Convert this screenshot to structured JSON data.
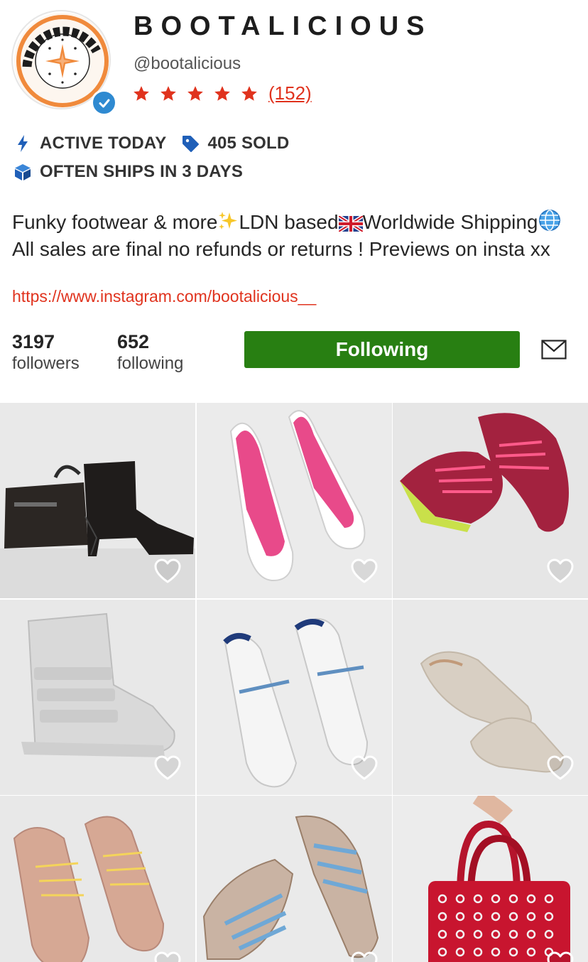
{
  "profile": {
    "name": "BOOTALICIOUS",
    "handle": "@bootalicious",
    "rating_stars": 5,
    "reviews": "(152)",
    "avatar_icon": "bootalicious-logo",
    "verified_icon": "verified-check-icon"
  },
  "badges": {
    "active": "ACTIVE TODAY",
    "sold": "405 SOLD",
    "shipping": "OFTEN SHIPS IN 3 DAYS"
  },
  "bio": {
    "part1": "Funky footwear & more",
    "part2": "LDN based",
    "part3": "Worldwide Shipping",
    "part4": " All sales are final no refunds or returns ! Previews on insta xx",
    "link": "https://www.instagram.com/bootalicious__"
  },
  "stats": {
    "followers_count": "3197",
    "followers_label": "followers",
    "following_count": "652",
    "following_label": "following"
  },
  "actions": {
    "follow_label": "Following",
    "message_icon": "envelope-icon"
  },
  "colors": {
    "accent": "#e0331e",
    "follow_button": "#287f12",
    "badge_icon": "#1f5fb8"
  },
  "listings": [
    {
      "name": "black leather boots and bag",
      "liked": false
    },
    {
      "name": "pink and white puma ballet flats",
      "liked": false
    },
    {
      "name": "magenta adidas sneakers",
      "liked": false
    },
    {
      "name": "white wedge high-top sneakers",
      "liked": false
    },
    {
      "name": "white y-3 sneakers",
      "liked": false
    },
    {
      "name": "beige suede mary jane flats",
      "liked": false
    },
    {
      "name": "pink suede lace-up sneakers",
      "liked": false
    },
    {
      "name": "beige and blue y-3 sneakers",
      "liked": false
    },
    {
      "name": "red eyelet handbag",
      "liked": false
    }
  ]
}
